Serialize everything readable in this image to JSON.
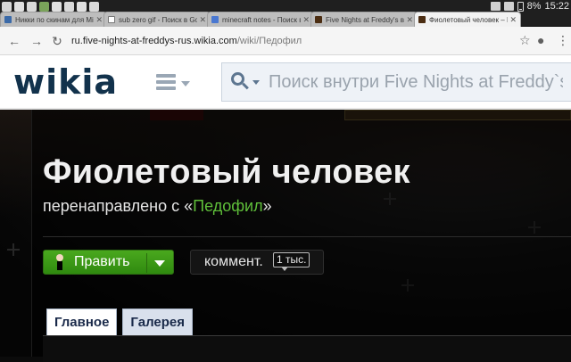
{
  "status_bar": {
    "battery": "8%",
    "time": "15:22"
  },
  "tabs": [
    {
      "title": "Никки по скинам для Minec",
      "icon": "doc-favicon"
    },
    {
      "title": "sub zero gif - Поиск в Google",
      "icon": "doc-favicon"
    },
    {
      "title": "minecraft notes - Поиск в G",
      "icon": "google-favicon"
    },
    {
      "title": "Five Nights at Freddy's вики",
      "icon": "fnaf-favicon"
    },
    {
      "title": "Фиолетовый человек – Fi",
      "icon": "fnaf-favicon"
    }
  ],
  "urlbar": {
    "host": "ru.five-nights-at-freddys-rus.wikia.com",
    "path": "/wiki/Педофил"
  },
  "header": {
    "logo": "wikia",
    "search_placeholder": "Поиск внутри Five Nights at Freddy`s вики"
  },
  "article": {
    "title": "Фиолетовый человек",
    "redirect_prefix": "перенаправлено с «",
    "redirect_link": "Педофил",
    "redirect_suffix": "»",
    "edit_label": "Править",
    "comment_label": "коммент.",
    "comment_count": "1 тыс.",
    "tabs": [
      "Главное",
      "Галерея"
    ]
  }
}
